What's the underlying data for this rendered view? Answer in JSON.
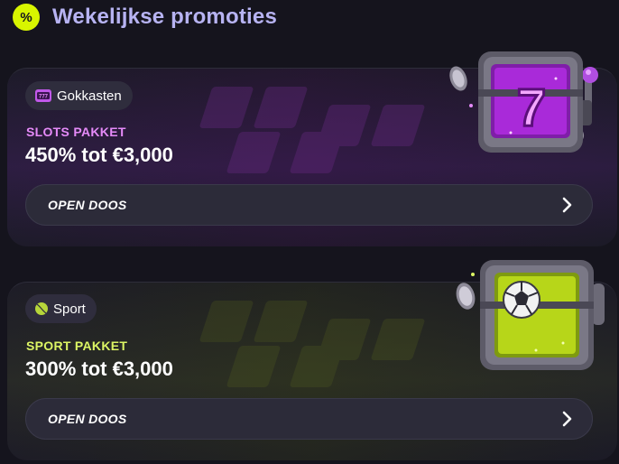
{
  "header": {
    "badge_glyph": "%",
    "title": "Wekelijkse promoties"
  },
  "promotions": [
    {
      "tag_label": "Gokkasten",
      "tag_icon": "slot-machine-icon",
      "package_title": "SLOTS PAKKET",
      "amount": "450% tot €3,000",
      "button_label": "OPEN DOOS",
      "accent": "#e58af8",
      "chest_glyph": "7"
    },
    {
      "tag_label": "Sport",
      "tag_icon": "tennis-ball-icon",
      "package_title": "SPORT PAKKET",
      "amount": "300% tot €3,000",
      "button_label": "OPEN DOOS",
      "accent": "#dcf564"
    }
  ],
  "colors": {
    "background": "#15141d",
    "header_title": "#b7b3f2",
    "badge": "#d8f500",
    "button_bg": "#2c2b39"
  }
}
